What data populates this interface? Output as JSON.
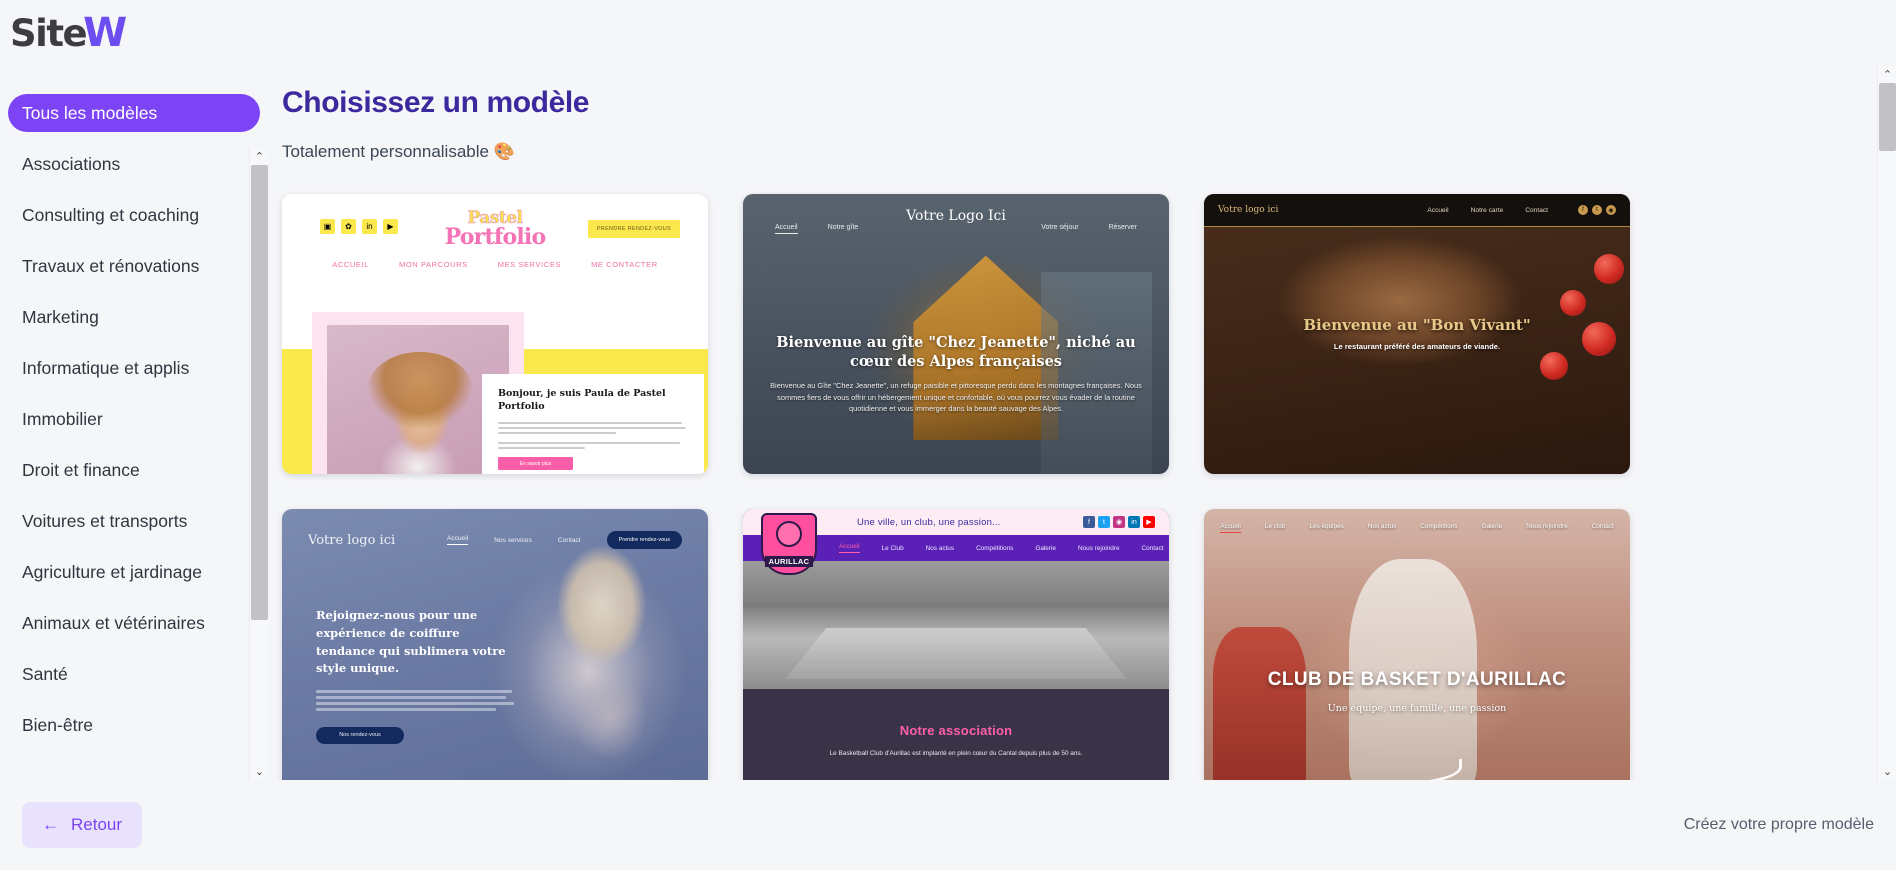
{
  "brand": {
    "name_dark": "Site",
    "name_accent": "W",
    "accent_color": "#6c4df0"
  },
  "sidebar": {
    "items": [
      {
        "label": "Tous les modèles",
        "active": true
      },
      {
        "label": "Associations",
        "active": false
      },
      {
        "label": "Consulting et coaching",
        "active": false
      },
      {
        "label": "Travaux et rénovations",
        "active": false
      },
      {
        "label": "Marketing",
        "active": false
      },
      {
        "label": "Informatique et applis",
        "active": false
      },
      {
        "label": "Immobilier",
        "active": false
      },
      {
        "label": "Droit et finance",
        "active": false
      },
      {
        "label": "Voitures et transports",
        "active": false
      },
      {
        "label": "Agriculture et jardinage",
        "active": false
      },
      {
        "label": "Animaux et vétérinaires",
        "active": false
      },
      {
        "label": "Santé",
        "active": false
      },
      {
        "label": "Bien-être",
        "active": false
      }
    ],
    "active_color": "#7c44f5"
  },
  "main": {
    "title": "Choisissez un modèle",
    "subtitle": "Totalement personnalisable",
    "subtitle_emoji": "🎨",
    "title_color": "#3b2a9e"
  },
  "templates": [
    {
      "id": "pastel-portfolio",
      "brand_line1": "Pastel",
      "brand_line2": "Portfolio",
      "appointment_button": "PRENDRE RENDEZ-VOUS",
      "nav": [
        "ACCUEIL",
        "MON PARCOURS",
        "MES SERVICES",
        "ME CONTACTER"
      ],
      "socials": [
        "instagram-icon",
        "pinterest-icon",
        "linkedin-icon",
        "youtube-icon"
      ],
      "heading": "Bonjour, je suis Paula de Pastel Portfolio",
      "cta": "En savoir plus"
    },
    {
      "id": "gite-chez-jeanette",
      "logo": "Votre Logo Ici",
      "nav_left": [
        "Accueil",
        "Notre gîte"
      ],
      "nav_right": [
        "Votre séjour",
        "Réserver"
      ],
      "heading": "Bienvenue au gîte \"Chez Jeanette\", niché au cœur des Alpes françaises",
      "body": "Bienvenue au Gîte \"Chez Jeanette\", un refuge paisible et pittoresque perdu dans les montagnes françaises. Nous sommes fiers de vous offrir un hébergement unique et confortable, où vous pourrez vous évader de la routine quotidienne et vous immerger dans la beauté sauvage des Alpes."
    },
    {
      "id": "bon-vivant-restaurant",
      "logo": "Votre logo ici",
      "nav": [
        "Accueil",
        "Notre carte",
        "Contact"
      ],
      "socials": [
        "facebook-icon",
        "twitter-icon",
        "instagram-icon"
      ],
      "heading": "Bienvenue au \"Bon Vivant\"",
      "subheading": "Le restaurant préféré des amateurs de viande."
    },
    {
      "id": "salon-coiffure",
      "logo": "Votre logo ici",
      "nav": [
        "Accueil",
        "Nos services",
        "Contact"
      ],
      "appointment_button": "Prendre rendez-vous",
      "heading": "Rejoignez-nous pour une expérience de coiffure tendance qui sublimera votre style unique.",
      "cta": "Nos rendez-vous"
    },
    {
      "id": "aurillac-association",
      "crest_name": "AURILLAC",
      "tagline": "Une ville, un club, une passion...",
      "nav": [
        "Accueil",
        "Le Club",
        "Nos actus",
        "Compétitions",
        "Galerie",
        "Nous rejoindre",
        "Contact"
      ],
      "socials": [
        "facebook-icon",
        "twitter-icon",
        "instagram-icon",
        "linkedin-icon",
        "youtube-icon"
      ],
      "heading": "Notre association",
      "body": "Le Basketball Club d'Aurillac est implanté en plein cœur du Cantal depuis plus de 50 ans."
    },
    {
      "id": "club-basket-aurillac",
      "nav": [
        "Accueil",
        "Le club",
        "Les équipes",
        "Nos actus",
        "Compétitions",
        "Galerie",
        "Nous rejoindre",
        "Contact"
      ],
      "heading": "CLUB DE BASKET D'AURILLAC",
      "subheading": "Une équipe, une famille, une passion"
    }
  ],
  "footer": {
    "back_label": "Retour",
    "back_arrow": "←",
    "own_model_label": "Créez votre propre modèle"
  },
  "scrollbars": {
    "up_arrow": "⌃",
    "down_arrow": "⌄"
  }
}
